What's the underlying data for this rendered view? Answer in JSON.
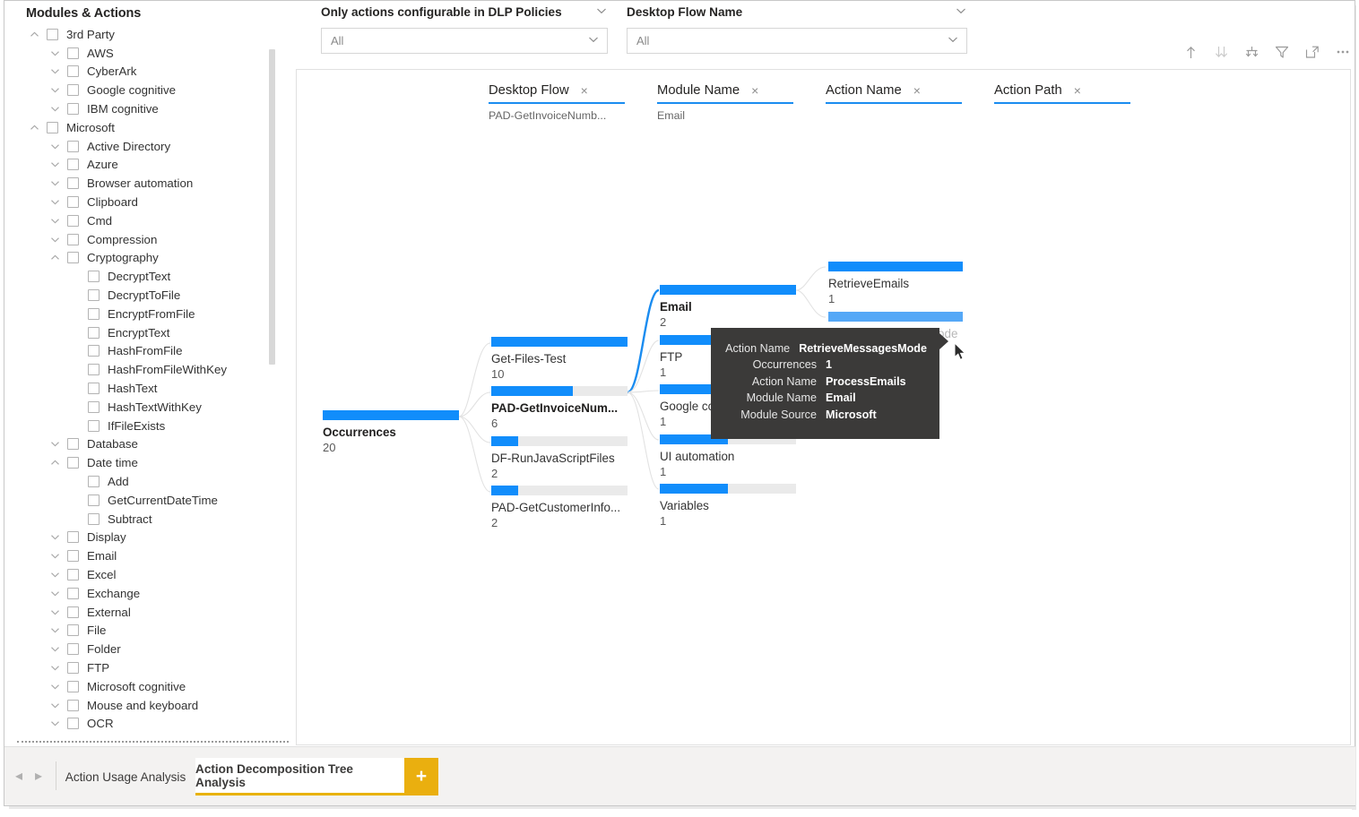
{
  "slicer": {
    "title": "Modules & Actions",
    "items": [
      {
        "label": "3rd Party",
        "level": 0,
        "chevron": "chevron-up-icon",
        "checkbox": true
      },
      {
        "label": "AWS",
        "level": 1,
        "chevron": "chevron-down-icon",
        "checkbox": true
      },
      {
        "label": "CyberArk",
        "level": 1,
        "chevron": "chevron-down-icon",
        "checkbox": true
      },
      {
        "label": "Google cognitive",
        "level": 1,
        "chevron": "chevron-down-icon",
        "checkbox": true
      },
      {
        "label": "IBM cognitive",
        "level": 1,
        "chevron": "chevron-down-icon",
        "checkbox": true
      },
      {
        "label": "Microsoft",
        "level": 0,
        "chevron": "chevron-up-icon",
        "checkbox": true
      },
      {
        "label": "Active Directory",
        "level": 1,
        "chevron": "chevron-down-icon",
        "checkbox": true
      },
      {
        "label": "Azure",
        "level": 1,
        "chevron": "chevron-down-icon",
        "checkbox": true
      },
      {
        "label": "Browser automation",
        "level": 1,
        "chevron": "chevron-down-icon",
        "checkbox": true
      },
      {
        "label": "Clipboard",
        "level": 1,
        "chevron": "chevron-down-icon",
        "checkbox": true
      },
      {
        "label": "Cmd",
        "level": 1,
        "chevron": "chevron-down-icon",
        "checkbox": true
      },
      {
        "label": "Compression",
        "level": 1,
        "chevron": "chevron-down-icon",
        "checkbox": true
      },
      {
        "label": "Cryptography",
        "level": 1,
        "chevron": "chevron-up-icon",
        "checkbox": true
      },
      {
        "label": "DecryptText",
        "level": 2,
        "chevron": "",
        "checkbox": true
      },
      {
        "label": "DecryptToFile",
        "level": 2,
        "chevron": "",
        "checkbox": true
      },
      {
        "label": "EncryptFromFile",
        "level": 2,
        "chevron": "",
        "checkbox": true
      },
      {
        "label": "EncryptText",
        "level": 2,
        "chevron": "",
        "checkbox": true
      },
      {
        "label": "HashFromFile",
        "level": 2,
        "chevron": "",
        "checkbox": true
      },
      {
        "label": "HashFromFileWithKey",
        "level": 2,
        "chevron": "",
        "checkbox": true
      },
      {
        "label": "HashText",
        "level": 2,
        "chevron": "",
        "checkbox": true
      },
      {
        "label": "HashTextWithKey",
        "level": 2,
        "chevron": "",
        "checkbox": true
      },
      {
        "label": "IfFileExists",
        "level": 2,
        "chevron": "",
        "checkbox": true
      },
      {
        "label": "Database",
        "level": 1,
        "chevron": "chevron-down-icon",
        "checkbox": true
      },
      {
        "label": "Date time",
        "level": 1,
        "chevron": "chevron-up-icon",
        "checkbox": true
      },
      {
        "label": "Add",
        "level": 2,
        "chevron": "",
        "checkbox": true
      },
      {
        "label": "GetCurrentDateTime",
        "level": 2,
        "chevron": "",
        "checkbox": true
      },
      {
        "label": "Subtract",
        "level": 2,
        "chevron": "",
        "checkbox": true
      },
      {
        "label": "Display",
        "level": 1,
        "chevron": "chevron-down-icon",
        "checkbox": true
      },
      {
        "label": "Email",
        "level": 1,
        "chevron": "chevron-down-icon",
        "checkbox": true
      },
      {
        "label": "Excel",
        "level": 1,
        "chevron": "chevron-down-icon",
        "checkbox": true
      },
      {
        "label": "Exchange",
        "level": 1,
        "chevron": "chevron-down-icon",
        "checkbox": true
      },
      {
        "label": "External",
        "level": 1,
        "chevron": "chevron-down-icon",
        "checkbox": true
      },
      {
        "label": "File",
        "level": 1,
        "chevron": "chevron-down-icon",
        "checkbox": true
      },
      {
        "label": "Folder",
        "level": 1,
        "chevron": "chevron-down-icon",
        "checkbox": true
      },
      {
        "label": "FTP",
        "level": 1,
        "chevron": "chevron-down-icon",
        "checkbox": true
      },
      {
        "label": "Microsoft cognitive",
        "level": 1,
        "chevron": "chevron-down-icon",
        "checkbox": true
      },
      {
        "label": "Mouse and keyboard",
        "level": 1,
        "chevron": "chevron-down-icon",
        "checkbox": true
      },
      {
        "label": "OCR",
        "level": 1,
        "chevron": "chevron-down-icon",
        "checkbox": true
      }
    ]
  },
  "filters": [
    {
      "title": "Only actions configurable in DLP Policies",
      "value": "All",
      "placeholder": "All"
    },
    {
      "title": "Desktop Flow Name",
      "value": "All",
      "placeholder": "All"
    }
  ],
  "toolbar": {
    "icons": [
      {
        "name": "drill-up-icon",
        "title": "Drill up"
      },
      {
        "name": "expand-all-icon",
        "title": "Expand all down one level"
      },
      {
        "name": "drill-down-icon",
        "title": "Go to the next level"
      },
      {
        "name": "filter-icon",
        "title": "Filters"
      },
      {
        "name": "focus-mode-icon",
        "title": "Focus mode"
      },
      {
        "name": "more-options-icon",
        "title": "More options"
      }
    ]
  },
  "chart_data": {
    "type": "bar",
    "title": "Action Decomposition Tree Analysis",
    "columns": [
      {
        "label": "Desktop Flow",
        "subtitle": "PAD-GetInvoiceNumb...",
        "close": "×"
      },
      {
        "label": "Module Name",
        "subtitle": "Email",
        "close": "×"
      },
      {
        "label": "Action Name",
        "subtitle": "",
        "close": "×"
      },
      {
        "label": "Action Path",
        "subtitle": "",
        "close": "×"
      }
    ],
    "root": {
      "label": "Occurrences",
      "value": 20,
      "fill_pct": 100,
      "selected": true
    },
    "level1": [
      {
        "label": "Get-Files-Test",
        "value": 10,
        "fill_pct": 100,
        "selected": false
      },
      {
        "label": "PAD-GetInvoiceNum...",
        "value": 6,
        "fill_pct": 60,
        "selected": true
      },
      {
        "label": "DF-RunJavaScriptFiles",
        "value": 2,
        "fill_pct": 20,
        "selected": false
      },
      {
        "label": "PAD-GetCustomerInfo...",
        "value": 2,
        "fill_pct": 20,
        "selected": false
      }
    ],
    "level2": [
      {
        "label": "Email",
        "value": 2,
        "fill_pct": 100,
        "selected": true
      },
      {
        "label": "FTP",
        "value": 1,
        "fill_pct": 50,
        "selected": false
      },
      {
        "label": "Google cognitive",
        "value": 1,
        "fill_pct": 50,
        "selected": false
      },
      {
        "label": "UI automation",
        "value": 1,
        "fill_pct": 50,
        "selected": false
      },
      {
        "label": "Variables",
        "value": 1,
        "fill_pct": 50,
        "selected": false
      }
    ],
    "level3": [
      {
        "label": "RetrieveEmails",
        "value": 1,
        "fill_pct": 100,
        "selected": false,
        "highlighted": false
      },
      {
        "label": "RetrieveMessagesMode",
        "value": 1,
        "fill_pct": 100,
        "selected": false,
        "highlighted": true
      }
    ],
    "colors": {
      "bar": "#118DFB",
      "bar_hover": "#55A8F7",
      "track": "#eaeaea",
      "link": "#d9d9d9",
      "link_active": "#1a8cf0"
    }
  },
  "tooltip": {
    "rows": [
      {
        "key": "Action Name",
        "value": "RetrieveMessagesMode"
      },
      {
        "key": "Occurrences",
        "value": "1"
      },
      {
        "key": "Action Name",
        "value": "ProcessEmails"
      },
      {
        "key": "Module Name",
        "value": "Email"
      },
      {
        "key": "Module Source",
        "value": "Microsoft"
      }
    ]
  },
  "tabstrip": {
    "prev": "◂",
    "next": "▸",
    "tabs": [
      {
        "label": "Action Usage Analysis",
        "active": false
      },
      {
        "label": "Action Decomposition Tree Analysis",
        "active": true
      }
    ],
    "add_label": "+"
  }
}
